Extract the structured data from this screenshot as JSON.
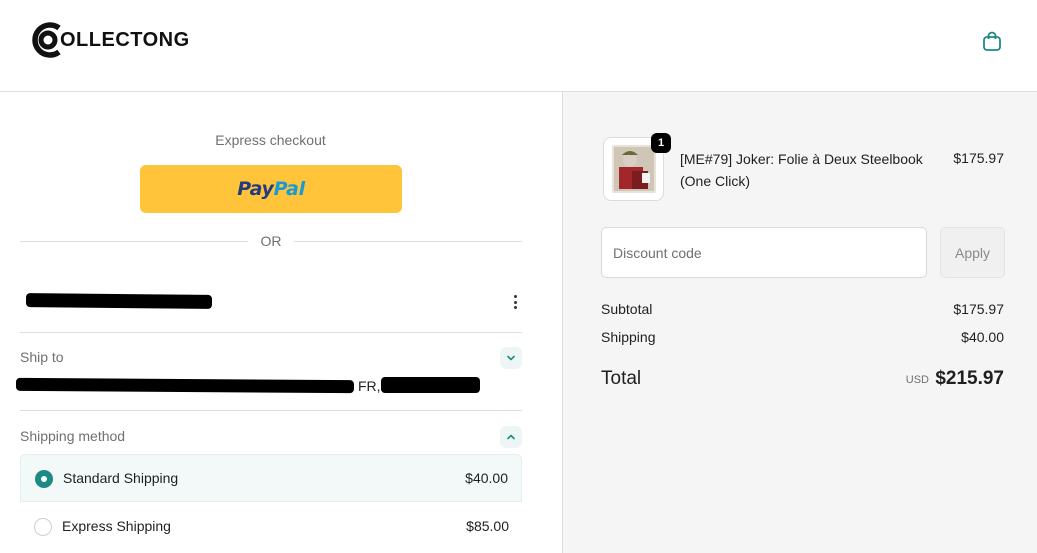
{
  "header": {
    "logo_text": "OLLECTONG",
    "cart_icon": "shopping-bag-icon"
  },
  "express": {
    "label": "Express checkout",
    "paypal_part1": "Pay",
    "paypal_part2": "Pal",
    "or_text": "OR"
  },
  "contact": {
    "menu_icon": "more-vertical-icon"
  },
  "ship_to": {
    "label": "Ship to",
    "country_fragment": "FR,",
    "icon": "chevron-down-icon"
  },
  "shipping_method": {
    "label": "Shipping method",
    "icon": "chevron-up-icon",
    "options": [
      {
        "label": "Standard Shipping",
        "price": "$40.00",
        "selected": true
      },
      {
        "label": "Express Shipping",
        "price": "$85.00",
        "selected": false
      }
    ]
  },
  "order": {
    "quantity": "1",
    "product_name": "[ME#79] Joker: Folie à Deux Steelbook (One Click)",
    "product_price": "$175.97"
  },
  "discount": {
    "placeholder": "Discount code",
    "apply_label": "Apply"
  },
  "summary": {
    "subtotal_label": "Subtotal",
    "subtotal_value": "$175.97",
    "shipping_label": "Shipping",
    "shipping_value": "$40.00",
    "total_label": "Total",
    "currency": "USD",
    "total_value": "$215.97"
  },
  "colors": {
    "paypal_yellow": "#ffc439",
    "accent_teal": "#1e8a84"
  }
}
